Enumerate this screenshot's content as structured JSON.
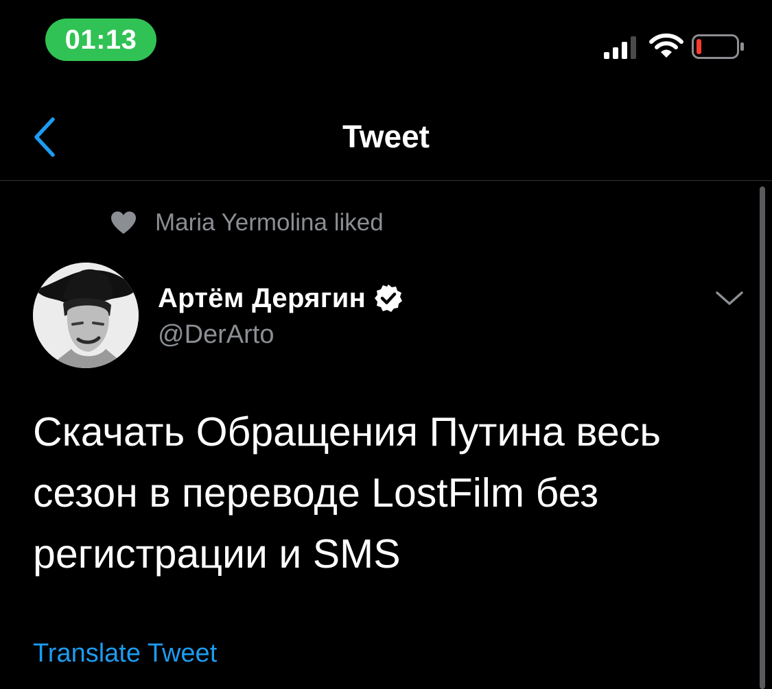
{
  "status_bar": {
    "time": "01:13",
    "signal_icon": "cellular-signal-icon",
    "wifi_icon": "wifi-icon",
    "battery_icon": "battery-icon",
    "battery_level": 0.12,
    "battery_color": "#ff3b30",
    "time_pill_color": "#30c254"
  },
  "nav": {
    "title": "Tweet",
    "back_icon": "chevron-left-icon",
    "accent": "#1d9bf0"
  },
  "social_context": {
    "icon": "heart-icon",
    "text": "Maria Yermolina liked"
  },
  "tweet": {
    "author_name": "Артём Дерягин",
    "verified": true,
    "verified_icon": "verified-badge-icon",
    "handle": "@DerArto",
    "text": "Скачать Обращения Путина весь сезон в переводе LostFilm без регистрации и SMS",
    "translate_label": "Translate Tweet",
    "more_icon": "chevron-down-icon"
  }
}
